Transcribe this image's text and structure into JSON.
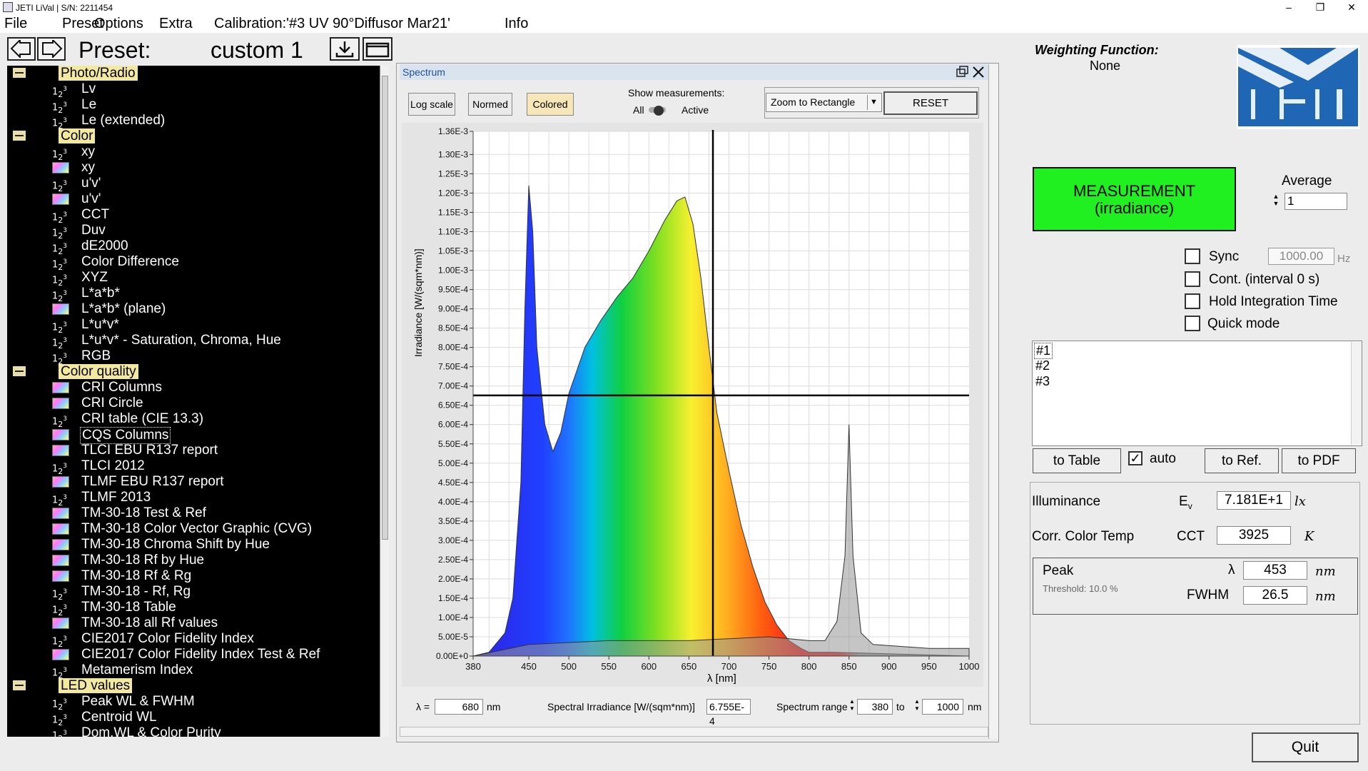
{
  "window": {
    "title": "JETI LiVal | S/N: 2211454",
    "minimize": "–",
    "maximize": "❐",
    "close": "✕"
  },
  "menu": {
    "file": "File",
    "preset": "Preset",
    "options": "Options",
    "extra": "Extra",
    "calibration": "Calibration:'#3  UV 90°Diffusor Mar21'",
    "info": "Info"
  },
  "preset": {
    "label": "Preset:",
    "name": "custom 1"
  },
  "tree": {
    "groups": [
      {
        "label": "Photo/Radio",
        "items": [
          {
            "icon": "num",
            "label": "Lv"
          },
          {
            "icon": "num",
            "label": "Le"
          },
          {
            "icon": "num",
            "label": "Le (extended)"
          }
        ]
      },
      {
        "label": "Color",
        "items": [
          {
            "icon": "num",
            "label": "xy"
          },
          {
            "icon": "pic",
            "label": "xy"
          },
          {
            "icon": "num",
            "label": "u'v'"
          },
          {
            "icon": "pic",
            "label": "u'v'"
          },
          {
            "icon": "num",
            "label": "CCT"
          },
          {
            "icon": "num",
            "label": "Duv"
          },
          {
            "icon": "num",
            "label": "dE2000"
          },
          {
            "icon": "num",
            "label": "Color Difference"
          },
          {
            "icon": "num",
            "label": "XYZ"
          },
          {
            "icon": "num",
            "label": "L*a*b*"
          },
          {
            "icon": "pic",
            "label": "L*a*b* (plane)"
          },
          {
            "icon": "num",
            "label": "L*u*v*"
          },
          {
            "icon": "num",
            "label": "L*u*v* - Saturation, Chroma, Hue"
          },
          {
            "icon": "num",
            "label": "RGB"
          }
        ]
      },
      {
        "label": "Color quality",
        "items": [
          {
            "icon": "pic",
            "label": "CRI Columns"
          },
          {
            "icon": "pic",
            "label": "CRI Circle"
          },
          {
            "icon": "num",
            "label": "CRI table (CIE 13.3)"
          },
          {
            "icon": "pic",
            "label": "CQS Columns",
            "selected": true
          },
          {
            "icon": "pic",
            "label": "TLCI EBU R137 report"
          },
          {
            "icon": "num",
            "label": "TLCI 2012"
          },
          {
            "icon": "pic",
            "label": "TLMF EBU R137 report"
          },
          {
            "icon": "num",
            "label": "TLMF 2013"
          },
          {
            "icon": "pic",
            "label": "TM-30-18 Test & Ref"
          },
          {
            "icon": "pic",
            "label": "TM-30-18 Color Vector Graphic (CVG)"
          },
          {
            "icon": "pic",
            "label": "TM-30-18 Chroma Shift by Hue"
          },
          {
            "icon": "pic",
            "label": "TM-30-18 Rf by Hue"
          },
          {
            "icon": "pic",
            "label": "TM-30-18 Rf & Rg"
          },
          {
            "icon": "num",
            "label": "TM-30-18 - Rf, Rg"
          },
          {
            "icon": "num",
            "label": "TM-30-18 Table"
          },
          {
            "icon": "pic",
            "label": "TM-30-18 all Rf values"
          },
          {
            "icon": "num",
            "label": "CIE2017 Color Fidelity Index"
          },
          {
            "icon": "pic",
            "label": "CIE2017 Color Fidelity Index Test & Ref"
          },
          {
            "icon": "num",
            "label": "Metamerism Index"
          }
        ]
      },
      {
        "label": "LED values",
        "items": [
          {
            "icon": "num",
            "label": "Peak WL & FWHM"
          },
          {
            "icon": "num",
            "label": "Centroid WL"
          },
          {
            "icon": "num",
            "label": "Dom.WL & Color Purity"
          }
        ]
      }
    ]
  },
  "spectrum": {
    "title": "Spectrum",
    "log_scale": "Log scale",
    "normed": "Normed",
    "colored": "Colored",
    "show_measurements": "Show measurements:",
    "all": "All",
    "active": "Active",
    "zoom": "Zoom to Rectangle",
    "reset": "RESET",
    "lambda_label": "λ =",
    "lambda_value": "680",
    "nm": "nm",
    "irr_label": "Spectral Irradiance [W/(sqm*nm)]",
    "irr_value": "6.755E-4",
    "range_label": "Spectrum range",
    "range_from": "380",
    "to": "to",
    "range_to": "1000",
    "nm2": "nm"
  },
  "chart_data": {
    "type": "area",
    "xlabel": "λ [nm]",
    "ylabel": "Irradiance [W/(sqm*nm)]",
    "xlim": [
      380,
      1000
    ],
    "ylim": [
      0,
      0.00136
    ],
    "x_ticks": [
      "380",
      "450",
      "500",
      "550",
      "600",
      "650",
      "700",
      "750",
      "800",
      "850",
      "900",
      "950",
      "1000"
    ],
    "y_ticks": [
      "0.00E+0",
      "5.00E-5",
      "1.00E-4",
      "1.50E-4",
      "2.00E-4",
      "2.50E-4",
      "3.00E-4",
      "3.50E-4",
      "4.00E-4",
      "4.50E-4",
      "5.00E-4",
      "5.50E-4",
      "6.00E-4",
      "6.50E-4",
      "7.00E-4",
      "7.50E-4",
      "8.00E-4",
      "8.50E-4",
      "9.00E-4",
      "9.50E-4",
      "1.00E-3",
      "1.05E-3",
      "1.10E-3",
      "1.15E-3",
      "1.20E-3",
      "1.25E-3",
      "1.30E-3",
      "1.36E-3"
    ],
    "grid": true,
    "cursor": {
      "x": 680,
      "y": 0.0006755
    },
    "series": [
      {
        "values": [
          [
            380,
            0
          ],
          [
            400,
            1e-05
          ],
          [
            420,
            6e-05
          ],
          [
            430,
            0.00015
          ],
          [
            440,
            0.00045
          ],
          [
            445,
            0.0009
          ],
          [
            450,
            0.00122
          ],
          [
            455,
            0.0011
          ],
          [
            460,
            0.0008
          ],
          [
            470,
            0.0006
          ],
          [
            480,
            0.00053
          ],
          [
            490,
            0.00058
          ],
          [
            500,
            0.00068
          ],
          [
            520,
            0.0008
          ],
          [
            540,
            0.00087
          ],
          [
            560,
            0.00093
          ],
          [
            580,
            0.00098
          ],
          [
            600,
            0.00105
          ],
          [
            620,
            0.00113
          ],
          [
            635,
            0.00118
          ],
          [
            645,
            0.00119
          ],
          [
            655,
            0.00112
          ],
          [
            665,
            0.00098
          ],
          [
            675,
            0.0008
          ],
          [
            685,
            0.00063
          ],
          [
            700,
            0.00048
          ],
          [
            715,
            0.00034
          ],
          [
            730,
            0.00023
          ],
          [
            745,
            0.00014
          ],
          [
            760,
            8e-05
          ],
          [
            775,
            4e-05
          ],
          [
            790,
            2e-05
          ],
          [
            800,
            1e-05
          ],
          [
            830,
            1e-05
          ],
          [
            1000,
            0
          ]
        ]
      },
      {
        "values": [
          [
            380,
            0
          ],
          [
            450,
            3e-05
          ],
          [
            550,
            4e-05
          ],
          [
            650,
            4e-05
          ],
          [
            750,
            5e-05
          ],
          [
            800,
            4e-05
          ],
          [
            820,
            4e-05
          ],
          [
            835,
            9e-05
          ],
          [
            845,
            0.00026
          ],
          [
            850,
            0.0006
          ],
          [
            855,
            0.00026
          ],
          [
            865,
            6e-05
          ],
          [
            880,
            3e-05
          ],
          [
            950,
            2e-05
          ],
          [
            1000,
            2e-05
          ]
        ]
      }
    ]
  },
  "right": {
    "wf_title": "Weighting Function:",
    "wf_value": "None",
    "measure_line1": "MEASUREMENT",
    "measure_line2": "(irradiance)",
    "average_label": "Average",
    "average_value": "1",
    "sync": "Sync",
    "sync_value": "1000.00",
    "hz": "Hz",
    "cont": "Cont. (interval 0 s)",
    "hold": "Hold Integration Time",
    "quick": "Quick mode",
    "list": [
      "#1",
      "#2",
      "#3"
    ],
    "to_table": "to Table",
    "auto": "auto",
    "to_ref": "to Ref.",
    "to_pdf": "to PDF",
    "illuminance": "Illuminance",
    "ev_sym": "E",
    "ev_sub": "v",
    "ev_value": "7.181E+1",
    "ev_unit": "lx",
    "cct_label": "Corr. Color Temp",
    "cct_sym": "CCT",
    "cct_value": "3925",
    "cct_unit": "K",
    "peak_label": "Peak",
    "threshold": "Threshold: 10.0 %",
    "lambda_sym": "λ",
    "peak_value": "453",
    "peak_unit": "nm",
    "fwhm_label": "FWHM",
    "fwhm_value": "26.5",
    "fwhm_unit": "nm",
    "quit": "Quit"
  }
}
